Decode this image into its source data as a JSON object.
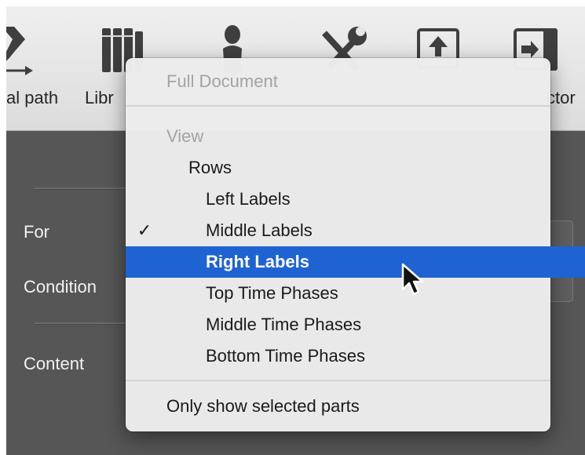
{
  "toolbar": {
    "critical_path_label": "al path",
    "library_label": "Libr",
    "inspector_label": "ctor"
  },
  "panel": {
    "for_label": "For",
    "condition_label": "Condition",
    "content_label": "Content"
  },
  "menu": {
    "full_document": "Full Document",
    "view_header": "View",
    "rows": "Rows",
    "items": [
      {
        "label": "Left Labels",
        "checked": false,
        "selected": false
      },
      {
        "label": "Middle Labels",
        "checked": true,
        "selected": false
      },
      {
        "label": "Right Labels",
        "checked": false,
        "selected": true
      },
      {
        "label": "Top Time Phases",
        "checked": false,
        "selected": false
      },
      {
        "label": "Middle Time Phases",
        "checked": false,
        "selected": false
      },
      {
        "label": "Bottom Time Phases",
        "checked": false,
        "selected": false
      }
    ],
    "only_selected": "Only show selected parts",
    "checkmark": "✓"
  },
  "colors": {
    "highlight": "#1f63d3",
    "panel_bg": "#565656",
    "toolbar_bg": "#e6e6e6"
  }
}
